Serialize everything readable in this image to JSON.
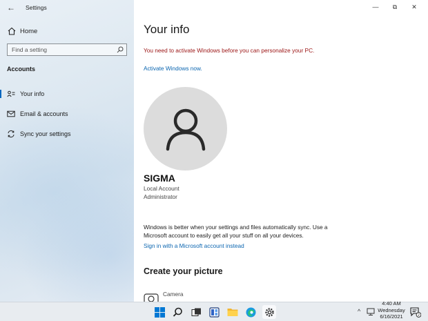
{
  "window": {
    "title": "Settings",
    "controls": {
      "minimize": "—",
      "maximize": "⧉",
      "close": "✕"
    }
  },
  "sidebar": {
    "home_label": "Home",
    "search_placeholder": "Find a setting",
    "section_title": "Accounts",
    "items": [
      {
        "label": "Your info",
        "icon": "person-card-icon",
        "selected": true
      },
      {
        "label": "Email & accounts",
        "icon": "mail-icon",
        "selected": false
      },
      {
        "label": "Sync your settings",
        "icon": "sync-icon",
        "selected": false
      }
    ]
  },
  "main": {
    "title": "Your info",
    "activation_warning": "You need to activate Windows before you can personalize your PC.",
    "activate_link": "Activate Windows now.",
    "username": "SIGMA",
    "account_type": "Local Account",
    "account_role": "Administrator",
    "sync_paragraph": "Windows is better when your settings and files automatically sync. Use a Microsoft account to easily get all your stuff on all your devices.",
    "ms_signin_link": "Sign in with a Microsoft account instead",
    "create_picture_heading": "Create your picture",
    "camera_label": "Camera"
  },
  "taskbar": {
    "icons": [
      "windows-start-icon",
      "search-icon",
      "task-view-icon",
      "widgets-icon",
      "file-explorer-icon",
      "edge-icon",
      "settings-icon"
    ],
    "tray_chevron": "^",
    "time": "4:40 AM",
    "day": "Wednesday",
    "date": "6/16/2021",
    "notification_count": "2"
  },
  "colors": {
    "accent": "#0067c0",
    "warning_text": "#9a1212",
    "link": "#0a65b0",
    "avatar_bg": "#dcdcdc"
  }
}
